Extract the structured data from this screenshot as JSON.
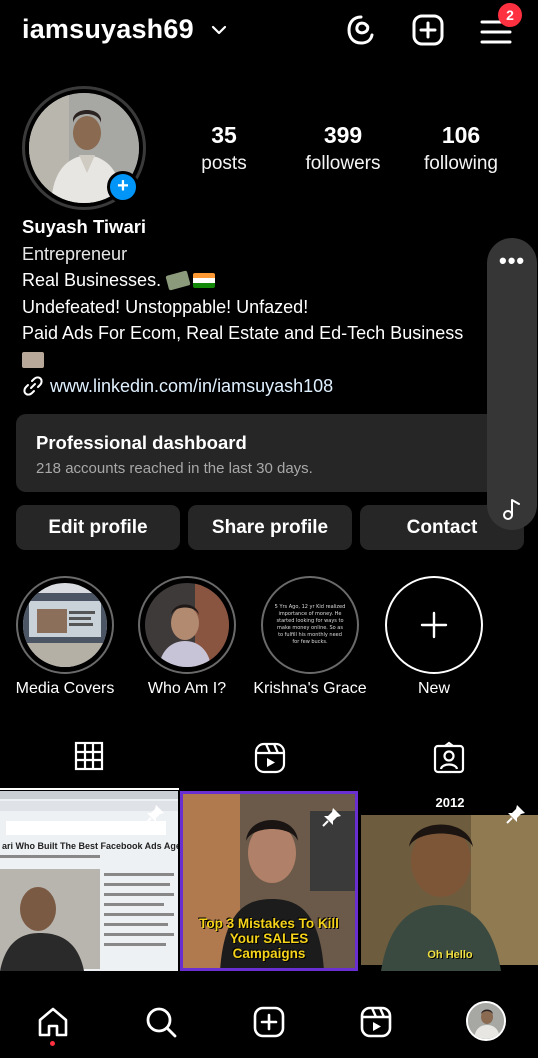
{
  "header": {
    "username": "iamsuyash69",
    "notification_count": "2"
  },
  "stats": [
    {
      "num": "35",
      "label": "posts"
    },
    {
      "num": "399",
      "label": "followers"
    },
    {
      "num": "106",
      "label": "following"
    }
  ],
  "bio": {
    "name": "Suyash Tiwari",
    "category": "Entrepreneur",
    "line1": "Real Businesses.",
    "line2": "Undefeated! Unstoppable! Unfazed!",
    "line3": "Paid Ads For Ecom, Real Estate and Ed-Tech Business",
    "link": "www.linkedin.com/in/iamsuyash108"
  },
  "dashboard": {
    "title": "Professional dashboard",
    "subtitle": "218 accounts reached in the last 30 days."
  },
  "buttons": {
    "edit": "Edit profile",
    "share": "Share profile",
    "contact": "Contact"
  },
  "highlights": [
    {
      "label": "Media Covers"
    },
    {
      "label": "Who Am I?"
    },
    {
      "label": "Krishna's Grace"
    },
    {
      "label": "New"
    }
  ],
  "highlight_krishna_text": "5 Yrs Ago, 12 yr Kid realized importance of money. He started looking for ways to make money online. So as to fulfill his monthly need for few bucks.",
  "posts": [
    {
      "caption": "ari Who Built The Best Facebook Ads Agency In In"
    },
    {
      "caption": "Top 3 Mistakes To Kill Your SALES Campaigns"
    },
    {
      "caption": "Oh Hello",
      "year": "2012"
    }
  ],
  "colors": {
    "accent": "#0095f6",
    "badge": "#ff3040",
    "surface": "#262626"
  }
}
